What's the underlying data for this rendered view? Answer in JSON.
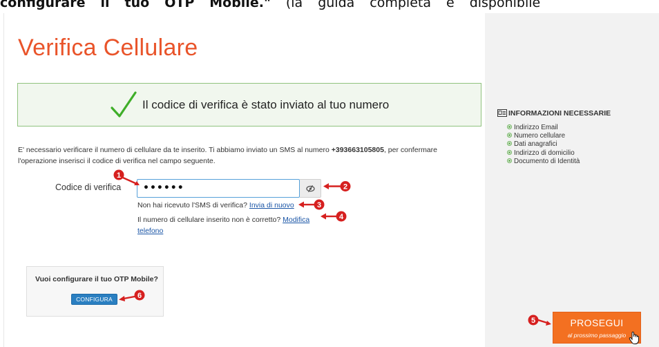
{
  "top_text": {
    "words": [
      "configurare",
      "il",
      "tuo",
      "OTP",
      "Mobile.\"",
      "(la",
      "guida",
      "completa",
      "è",
      "disponibile"
    ]
  },
  "page": {
    "title": "Verifica Cellulare"
  },
  "success": {
    "message": "Il codice di verifica è stato inviato al tuo numero",
    "icon": "check-icon",
    "color": "#3fae29"
  },
  "intro": {
    "text_before": "E' necessario verificare il numero di cellulare da te inserito. Ti abbiamo inviato un SMS al numero ",
    "phone": "+393663105805",
    "text_after": ", per confermare l'operazione inserisci il codice di verifica nel campo seguente."
  },
  "verification": {
    "label": "Codice di verifica",
    "value": "••••••",
    "toggle_icon": "eye-slash-icon"
  },
  "help": {
    "resend_text": "Non hai ricevuto l'SMS di verifica?",
    "resend_link": "Invia di nuovo",
    "wrong_number_text": "Il numero di cellulare inserito non è corretto?",
    "edit_phone_link": "Modifica telefono"
  },
  "otp": {
    "question": "Vuoi configurare il tuo OTP Mobile?",
    "button": "CONFIGURA"
  },
  "next": {
    "label": "PROSEGUI",
    "sublabel": "al prossimo passaggio"
  },
  "info": {
    "title": "INFORMAZIONI NECESSARIE",
    "icon": "id-card-icon",
    "items": [
      "Indirizzo Email",
      "Numero cellulare",
      "Dati anagrafici",
      "Indirizzo di domicilio",
      "Documento di Identità"
    ]
  },
  "callouts": [
    "1",
    "2",
    "3",
    "4",
    "5",
    "6"
  ],
  "colors": {
    "accent_title": "#e9542a",
    "callout_red": "#d6201f",
    "button_orange": "#f37021",
    "button_blue": "#2a7fc1",
    "link": "#1a55a6"
  }
}
